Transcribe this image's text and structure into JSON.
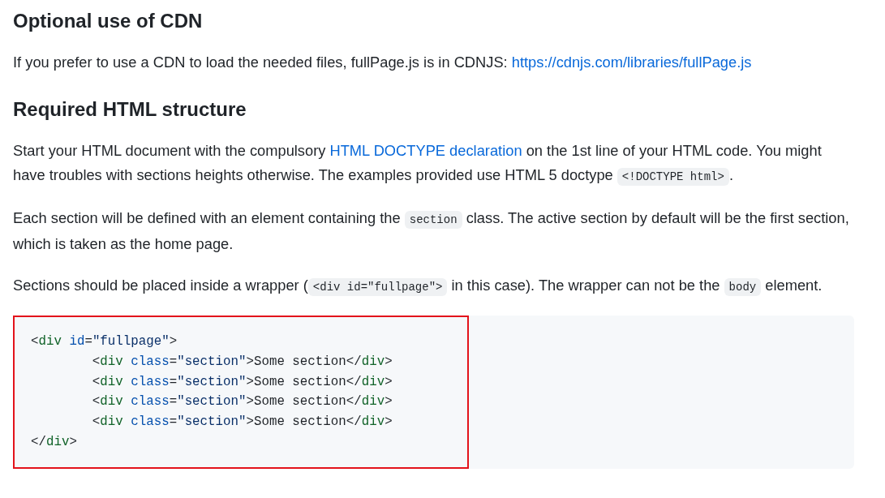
{
  "sections": [
    {
      "heading": "Optional use of CDN",
      "paragraphs": [
        [
          {
            "kind": "text",
            "text": "If you prefer to use a CDN to load the needed files, fullPage.js is in CDNJS: "
          },
          {
            "kind": "link",
            "text": "https://cdnjs.com/libraries/fullPage.js"
          }
        ]
      ]
    },
    {
      "heading": "Required HTML structure",
      "paragraphs": [
        [
          {
            "kind": "text",
            "text": "Start your HTML document with the compulsory "
          },
          {
            "kind": "link",
            "text": "HTML DOCTYPE declaration"
          },
          {
            "kind": "text",
            "text": " on the 1st line of your HTML code. You might have troubles with sections heights otherwise. The examples provided use HTML 5 doctype "
          },
          {
            "kind": "code",
            "text": "<!DOCTYPE html>"
          },
          {
            "kind": "text",
            "text": "."
          }
        ],
        [
          {
            "kind": "text",
            "text": "Each section will be defined with an element containing the "
          },
          {
            "kind": "code",
            "text": "section"
          },
          {
            "kind": "text",
            "text": " class. The active section by default will be the first section, which is taken as the home page."
          }
        ],
        [
          {
            "kind": "text",
            "text": "Sections should be placed inside a wrapper ("
          },
          {
            "kind": "code",
            "text": "<div id=\"fullpage\">"
          },
          {
            "kind": "text",
            "text": " in this case). The wrapper can not be the "
          },
          {
            "kind": "code",
            "text": "body"
          },
          {
            "kind": "text",
            "text": " element."
          }
        ]
      ]
    }
  ],
  "code_block": {
    "highlighted": true,
    "lines": [
      [
        {
          "kind": "punct",
          "text": "<"
        },
        {
          "kind": "tag",
          "text": "div"
        },
        {
          "kind": "attr",
          "text": " id"
        },
        {
          "kind": "punct",
          "text": "="
        },
        {
          "kind": "string",
          "text": "\"fullpage\""
        },
        {
          "kind": "punct",
          "text": ">"
        }
      ],
      [
        {
          "kind": "punct",
          "text": "\t<"
        },
        {
          "kind": "tag",
          "text": "div"
        },
        {
          "kind": "attr",
          "text": " class"
        },
        {
          "kind": "punct",
          "text": "="
        },
        {
          "kind": "string",
          "text": "\"section\""
        },
        {
          "kind": "punct",
          "text": ">Some section</"
        },
        {
          "kind": "tag",
          "text": "div"
        },
        {
          "kind": "punct",
          "text": ">"
        }
      ],
      [
        {
          "kind": "punct",
          "text": "\t<"
        },
        {
          "kind": "tag",
          "text": "div"
        },
        {
          "kind": "attr",
          "text": " class"
        },
        {
          "kind": "punct",
          "text": "="
        },
        {
          "kind": "string",
          "text": "\"section\""
        },
        {
          "kind": "punct",
          "text": ">Some section</"
        },
        {
          "kind": "tag",
          "text": "div"
        },
        {
          "kind": "punct",
          "text": ">"
        }
      ],
      [
        {
          "kind": "punct",
          "text": "\t<"
        },
        {
          "kind": "tag",
          "text": "div"
        },
        {
          "kind": "attr",
          "text": " class"
        },
        {
          "kind": "punct",
          "text": "="
        },
        {
          "kind": "string",
          "text": "\"section\""
        },
        {
          "kind": "punct",
          "text": ">Some section</"
        },
        {
          "kind": "tag",
          "text": "div"
        },
        {
          "kind": "punct",
          "text": ">"
        }
      ],
      [
        {
          "kind": "punct",
          "text": "\t<"
        },
        {
          "kind": "tag",
          "text": "div"
        },
        {
          "kind": "attr",
          "text": " class"
        },
        {
          "kind": "punct",
          "text": "="
        },
        {
          "kind": "string",
          "text": "\"section\""
        },
        {
          "kind": "punct",
          "text": ">Some section</"
        },
        {
          "kind": "tag",
          "text": "div"
        },
        {
          "kind": "punct",
          "text": ">"
        }
      ],
      [
        {
          "kind": "punct",
          "text": "</"
        },
        {
          "kind": "tag",
          "text": "div"
        },
        {
          "kind": "punct",
          "text": ">"
        }
      ]
    ]
  }
}
